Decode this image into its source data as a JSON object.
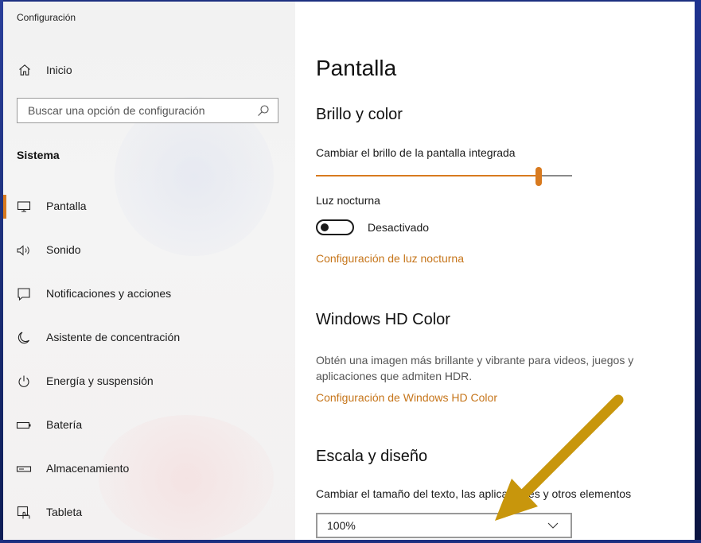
{
  "window": {
    "title": "Configuración"
  },
  "sidebar": {
    "home": {
      "label": "Inicio",
      "icon": "home-icon"
    },
    "search": {
      "placeholder": "Buscar una opción de configuración",
      "icon": "search-icon"
    },
    "section": "Sistema",
    "items": [
      {
        "label": "Pantalla",
        "icon": "monitor-icon",
        "selected": true
      },
      {
        "label": "Sonido",
        "icon": "speaker-icon",
        "selected": false
      },
      {
        "label": "Notificaciones y acciones",
        "icon": "notification-icon",
        "selected": false
      },
      {
        "label": "Asistente de concentración",
        "icon": "moon-icon",
        "selected": false
      },
      {
        "label": "Energía y suspensión",
        "icon": "power-icon",
        "selected": false
      },
      {
        "label": "Batería",
        "icon": "battery-icon",
        "selected": false
      },
      {
        "label": "Almacenamiento",
        "icon": "storage-icon",
        "selected": false
      },
      {
        "label": "Tableta",
        "icon": "tablet-icon",
        "selected": false
      }
    ]
  },
  "main": {
    "title": "Pantalla",
    "brightness_section": {
      "heading": "Brillo y color",
      "slider_label": "Cambiar el brillo de la pantalla integrada",
      "brightness_fraction": 0.88,
      "night_light_label": "Luz nocturna",
      "night_light_state": "Desactivado",
      "night_light_link": "Configuración de luz nocturna"
    },
    "hd_color": {
      "heading": "Windows HD Color",
      "description": "Obtén una imagen más brillante y vibrante para videos, juegos y aplicaciones que admiten HDR.",
      "link": "Configuración de Windows HD Color"
    },
    "scale": {
      "heading": "Escala y diseño",
      "label": "Cambiar el tamaño del texto, las aplicaciones y otros elementos",
      "selected_value": "100%"
    }
  },
  "colors": {
    "accent": "#d87a1f",
    "link": "#c6751a",
    "annotation_arrow": "#c8960c"
  }
}
